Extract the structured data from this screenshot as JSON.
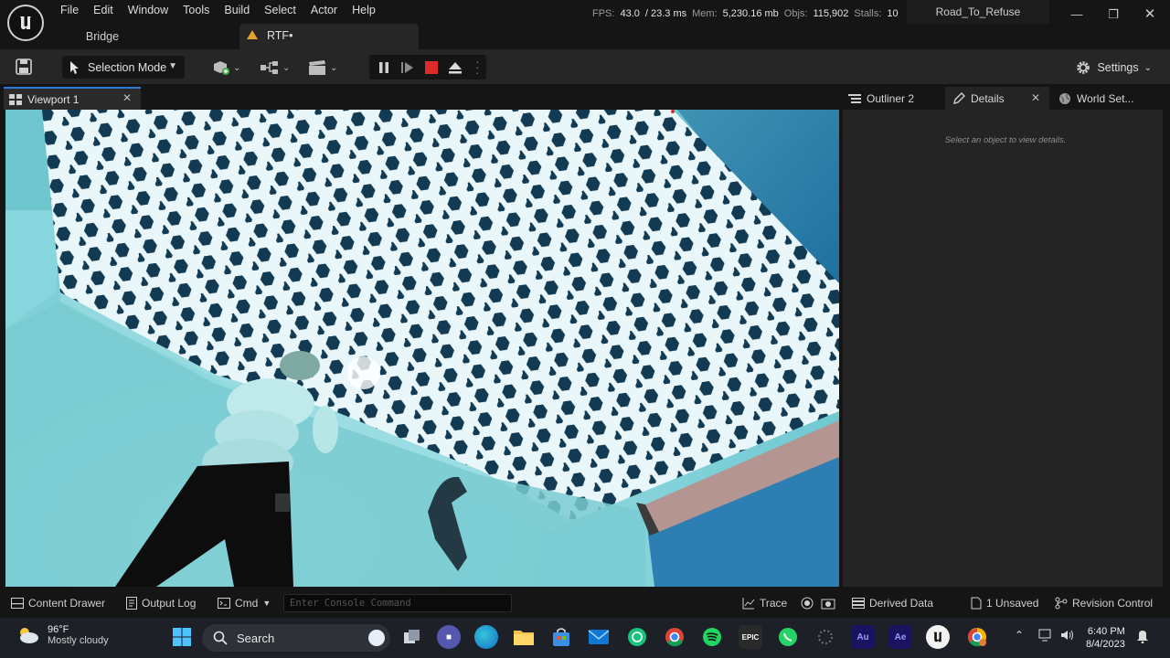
{
  "menu": [
    "File",
    "Edit",
    "Window",
    "Tools",
    "Build",
    "Select",
    "Actor",
    "Help"
  ],
  "stats": {
    "fps_label": "FPS:",
    "fps": "43.0",
    "ms": "/ 23.3 ms",
    "mem_label": "Mem:",
    "mem": "5,230.16 mb",
    "objs_label": "Objs:",
    "objs": "115,902",
    "stalls_label": "Stalls:",
    "stalls": "10"
  },
  "project_title": "Road_To_Refuse",
  "doc_tabs": {
    "bridge": "Bridge",
    "level": "RTF•"
  },
  "toolbar": {
    "selection_mode": "Selection Mode",
    "settings": "Settings"
  },
  "panels": {
    "viewport_tab": "Viewport 1",
    "outliner_tab": "Outliner 2",
    "details_tab": "Details",
    "world_settings_tab": "World Set...",
    "details_hint": "Select an object to view details."
  },
  "statusbar": {
    "content_drawer": "Content Drawer",
    "output_log": "Output Log",
    "cmd": "Cmd",
    "console_placeholder": "Enter Console Command",
    "trace": "Trace",
    "derived_data": "Derived Data",
    "unsaved": "1 Unsaved",
    "revision_control": "Revision Control"
  },
  "taskbar": {
    "temperature": "96°F",
    "weather": "Mostly cloudy",
    "search": "Search",
    "time": "6:40 PM",
    "date": "8/4/2023",
    "apps": [
      "windows-start",
      "search",
      "task-view",
      "teams",
      "edge",
      "file-explorer",
      "store",
      "mail",
      "chatgpt",
      "chrome",
      "spotify",
      "epic-games",
      "whatsapp",
      "loading",
      "audition",
      "after-effects",
      "unreal-engine",
      "chrome-profile"
    ]
  },
  "colors": {
    "accent": "#2a7bd6",
    "warning": "#e8a32c",
    "stop": "#e02b2b",
    "viewport_sky": "#8ecfd8",
    "grid_dark": "#0f2f45"
  }
}
